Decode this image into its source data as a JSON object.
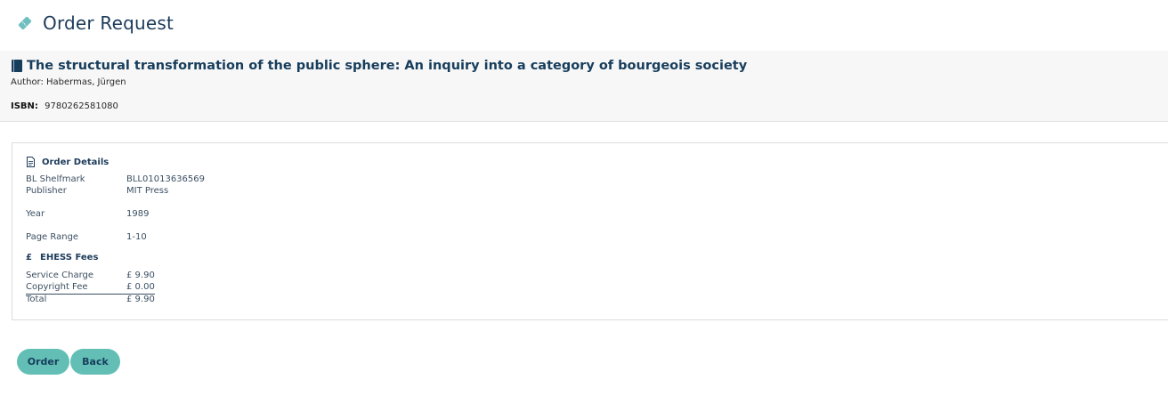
{
  "header": {
    "title": "Order Request",
    "icon": "tag-icon"
  },
  "book": {
    "icon": "book-icon",
    "title": "The structural transformation of the public sphere: An inquiry into a category of bourgeois society",
    "author_line": "Author: Habermas, Jürgen",
    "isbn_label": "ISBN:",
    "isbn_value": "9780262581080"
  },
  "order_details": {
    "heading": "Order Details",
    "icon": "document-icon",
    "rows": [
      {
        "label": "BL Shelfmark",
        "value": "BLL01013636569"
      },
      {
        "label": "Publisher",
        "value": "MIT Press"
      },
      {
        "label": "Year",
        "value": "1989"
      },
      {
        "label": "Page Range",
        "value": "1-10"
      }
    ]
  },
  "fees": {
    "heading": "EHESS Fees",
    "icon_glyph": "£",
    "rows": [
      {
        "label": "Service Charge",
        "value": "£ 9.90"
      },
      {
        "label": "Copyright Fee",
        "value": "£ 0.00"
      },
      {
        "label": "Total",
        "value": "£ 9.90"
      }
    ]
  },
  "actions": {
    "order_label": "Order",
    "back_label": "Back"
  },
  "colors": {
    "accent": "#63bfb5",
    "heading": "#1c3b5a",
    "panel_bg": "#f7f7f7"
  }
}
